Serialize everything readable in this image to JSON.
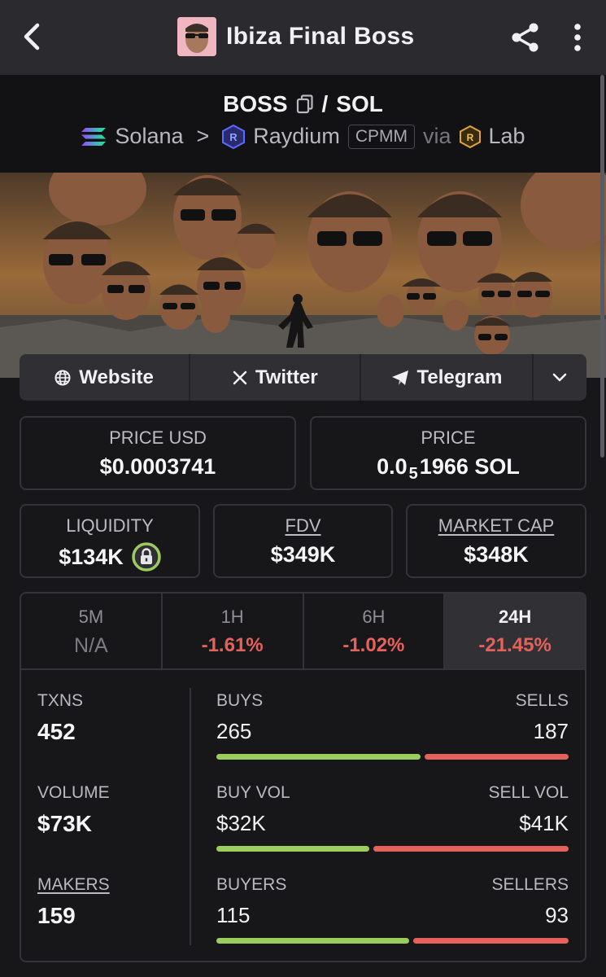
{
  "header": {
    "title": "Ibiza Final Boss"
  },
  "pair": {
    "base": "BOSS",
    "separator": "/",
    "quote": "SOL",
    "chain": "Solana",
    "chevron": ">",
    "dex": "Raydium",
    "pool_type": "CPMM",
    "via": "via",
    "launchpad": "Lab"
  },
  "links": {
    "website": "Website",
    "twitter": "Twitter",
    "telegram": "Telegram"
  },
  "price": {
    "usd_label": "PRICE USD",
    "usd_value": "$0.0003741",
    "native_label": "PRICE",
    "native_prefix": "0.0",
    "native_zeros": "5",
    "native_suffix": "1966 SOL"
  },
  "metrics": {
    "liquidity_label": "LIQUIDITY",
    "liquidity_value": "$134K",
    "fdv_label": "FDV",
    "fdv_value": "$349K",
    "mcap_label": "MARKET CAP",
    "mcap_value": "$348K"
  },
  "timeframes": [
    {
      "label": "5M",
      "value": "N/A"
    },
    {
      "label": "1H",
      "value": "-1.61%"
    },
    {
      "label": "6H",
      "value": "-1.02%"
    },
    {
      "label": "24H",
      "value": "-21.45%"
    }
  ],
  "active_timeframe": "24H",
  "stats": {
    "txns_label": "TXNS",
    "txns_value": "452",
    "volume_label": "VOLUME",
    "volume_value": "$73K",
    "makers_label": "MAKERS",
    "makers_value": "159",
    "buys_label": "BUYS",
    "buys_value": "265",
    "sells_label": "SELLS",
    "sells_value": "187",
    "buyvol_label": "BUY VOL",
    "buyvol_value": "$32K",
    "sellvol_label": "SELL VOL",
    "sellvol_value": "$41K",
    "buyers_label": "BUYERS",
    "buyers_value": "115",
    "sellers_label": "SELLERS",
    "sellers_value": "93",
    "buy_fraction": 0.586,
    "buyvol_fraction": 0.44,
    "buyers_fraction": 0.553
  },
  "colors": {
    "positive": "#9ccc5e",
    "negative": "#e5625c",
    "background": "#17171a",
    "surface": "#303034"
  },
  "icons": [
    "back-arrow-icon",
    "share-icon",
    "more-vertical-icon",
    "copy-icon",
    "solana-icon",
    "raydium-icon",
    "lab-icon",
    "globe-icon",
    "x-icon",
    "telegram-icon",
    "chevron-down-icon",
    "lock-icon"
  ]
}
